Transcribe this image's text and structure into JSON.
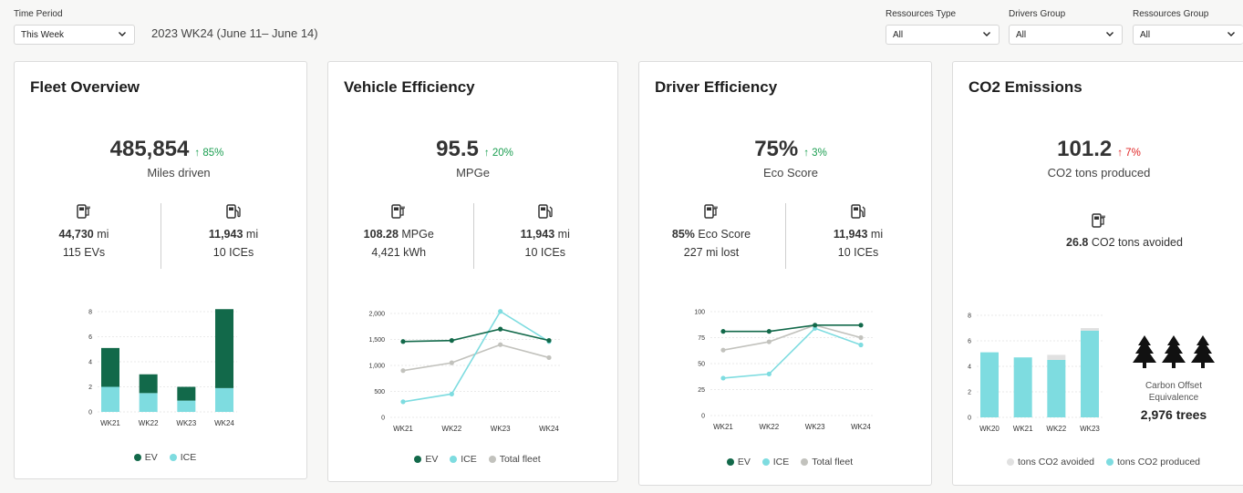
{
  "filters": {
    "time_period_label": "Time Period",
    "time_period_value": "This Week",
    "period_text": "2023 WK24  (June 11– June 14)",
    "resources_type_label": "Ressources Type",
    "resources_type_value": "All",
    "drivers_group_label": "Drivers Group",
    "drivers_group_value": "All",
    "resources_group_label": "Ressources Group",
    "resources_group_value": "All"
  },
  "colors": {
    "ev": "#12694a",
    "ice": "#7edce0",
    "total": "#c2c2bd",
    "avoided": "#e1e1e1",
    "up": "#1a9e50",
    "bad": "#e02424"
  },
  "cards": {
    "fleet": {
      "title": "Fleet Overview",
      "kpi": "485,854",
      "delta": "↑ 85%",
      "kpi_label": "Miles driven",
      "left": {
        "value": "44,730",
        "unit": "mi",
        "sub": "115  EVs",
        "icon": "ev-charger-icon"
      },
      "right": {
        "value": "11,943",
        "unit": "mi",
        "sub": "10  ICEs",
        "icon": "fuel-pump-icon"
      },
      "legend": [
        "EV",
        "ICE"
      ]
    },
    "vehicle": {
      "title": "Vehicle Efficiency",
      "kpi": "95.5",
      "delta": "↑ 20%",
      "kpi_label": "MPGe",
      "left": {
        "value": "108.28",
        "unit": "MPGe",
        "sub": "4,421  kWh",
        "icon": "ev-charger-icon"
      },
      "right": {
        "value": "11,943",
        "unit": "mi",
        "sub": "10  ICEs",
        "icon": "fuel-pump-icon"
      },
      "legend": [
        "EV",
        "ICE",
        "Total fleet"
      ]
    },
    "driver": {
      "title": "Driver Efficiency",
      "kpi": "75%",
      "delta": "↑ 3%",
      "kpi_label": "Eco Score",
      "left": {
        "value": "85%",
        "unit": "Eco Score",
        "sub": "227  mi lost",
        "icon": "ev-charger-icon"
      },
      "right": {
        "value": "11,943",
        "unit": "mi",
        "sub": "10  ICEs",
        "icon": "fuel-pump-icon"
      },
      "legend": [
        "EV",
        "ICE",
        "Total fleet"
      ]
    },
    "co2": {
      "title": "CO2 Emissions",
      "kpi": "101.2",
      "delta": "↑ 7%",
      "kpi_label": "CO2 tons produced",
      "avoided_value": "26.8",
      "avoided_label": "CO2 tons avoided",
      "trees_label": "Carbon Offset Equivalence",
      "trees_count": "2,976 trees",
      "legend": [
        "tons CO2 avoided",
        "tons CO2 produced"
      ]
    }
  },
  "chart_data": [
    {
      "type": "bar",
      "categories": [
        "WK21",
        "WK22",
        "WK23",
        "WK24"
      ],
      "series": [
        {
          "name": "ICE",
          "values": [
            2,
            1.5,
            0.9,
            1.9
          ]
        },
        {
          "name": "EV",
          "values": [
            3.1,
            1.5,
            1.1,
            6.3
          ]
        }
      ],
      "stacked": true,
      "yticks": [
        "0",
        "2",
        "4",
        "6",
        "8"
      ],
      "ylim": [
        0,
        8
      ]
    },
    {
      "type": "line",
      "categories": [
        "WK21",
        "WK22",
        "WK23",
        "WK24"
      ],
      "series": [
        {
          "name": "EV",
          "values": [
            1460,
            1480,
            1700,
            1480
          ]
        },
        {
          "name": "ICE",
          "values": [
            300,
            450,
            2040,
            1460
          ]
        },
        {
          "name": "Total fleet",
          "values": [
            900,
            1050,
            1400,
            1150
          ]
        }
      ],
      "yticks": [
        "0",
        "500",
        "1,000",
        "1,500",
        "2,000"
      ],
      "ylim": [
        0,
        2000
      ]
    },
    {
      "type": "line",
      "categories": [
        "WK21",
        "WK22",
        "WK23",
        "WK24"
      ],
      "series": [
        {
          "name": "EV",
          "values": [
            81,
            81,
            87,
            87
          ]
        },
        {
          "name": "ICE",
          "values": [
            36,
            40,
            84,
            68
          ]
        },
        {
          "name": "Total fleet",
          "values": [
            63,
            71,
            87,
            75
          ]
        }
      ],
      "yticks": [
        "0",
        "25",
        "50",
        "75",
        "100"
      ],
      "ylim": [
        0,
        100
      ]
    },
    {
      "type": "bar",
      "categories": [
        "WK20",
        "WK21",
        "WK22",
        "WK23"
      ],
      "series": [
        {
          "name": "tons CO2 produced",
          "values": [
            5.1,
            4.7,
            4.5,
            6.8
          ]
        },
        {
          "name": "tons CO2 avoided",
          "values": [
            0,
            0,
            0.4,
            0.2
          ]
        }
      ],
      "stacked": true,
      "yticks": [
        "0",
        "2",
        "4",
        "6",
        "8"
      ],
      "ylim": [
        0,
        8
      ]
    }
  ]
}
